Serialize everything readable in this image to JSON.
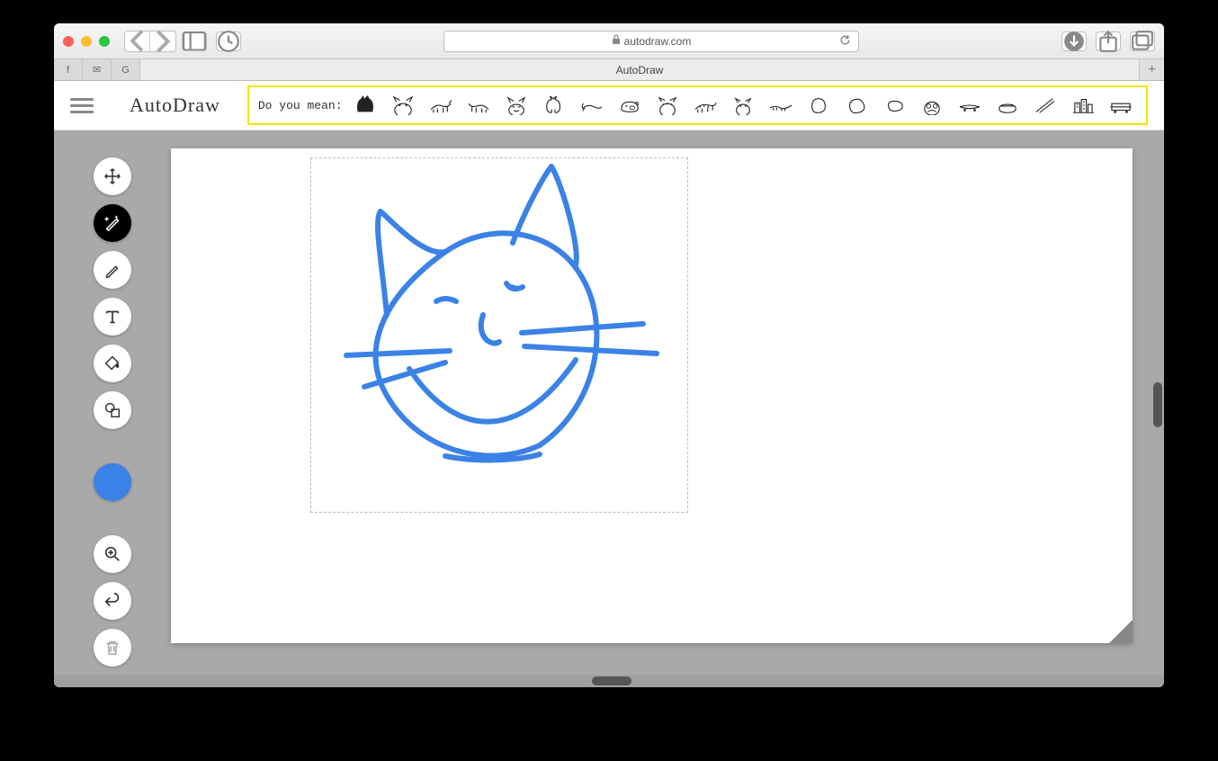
{
  "browser": {
    "url": "autodraw.com",
    "tab_title": "AutoDraw"
  },
  "app": {
    "logo": "AutoDraw",
    "suggest_label": "Do you mean:",
    "suggestions": [
      "cat-silhouette",
      "cat-face-1",
      "cat-walking-1",
      "cat-walking-2",
      "cat-face-2",
      "cat-sitting",
      "mouse",
      "pig",
      "tiger-face",
      "tiger-body",
      "tiger-head",
      "lizard",
      "potato-1",
      "potato-2",
      "potato-3",
      "monster-face",
      "skateboard",
      "sushi",
      "chopsticks",
      "building",
      "train-car"
    ],
    "tools": {
      "move": "Move",
      "autodraw": "AutoDraw",
      "draw": "Draw",
      "type": "Type",
      "fill": "Fill",
      "shape": "Shape",
      "color": "Color",
      "zoom": "Zoom",
      "undo": "Undo",
      "delete": "Delete"
    },
    "active_tool": "autodraw",
    "draw_color": "#3b82e6"
  }
}
